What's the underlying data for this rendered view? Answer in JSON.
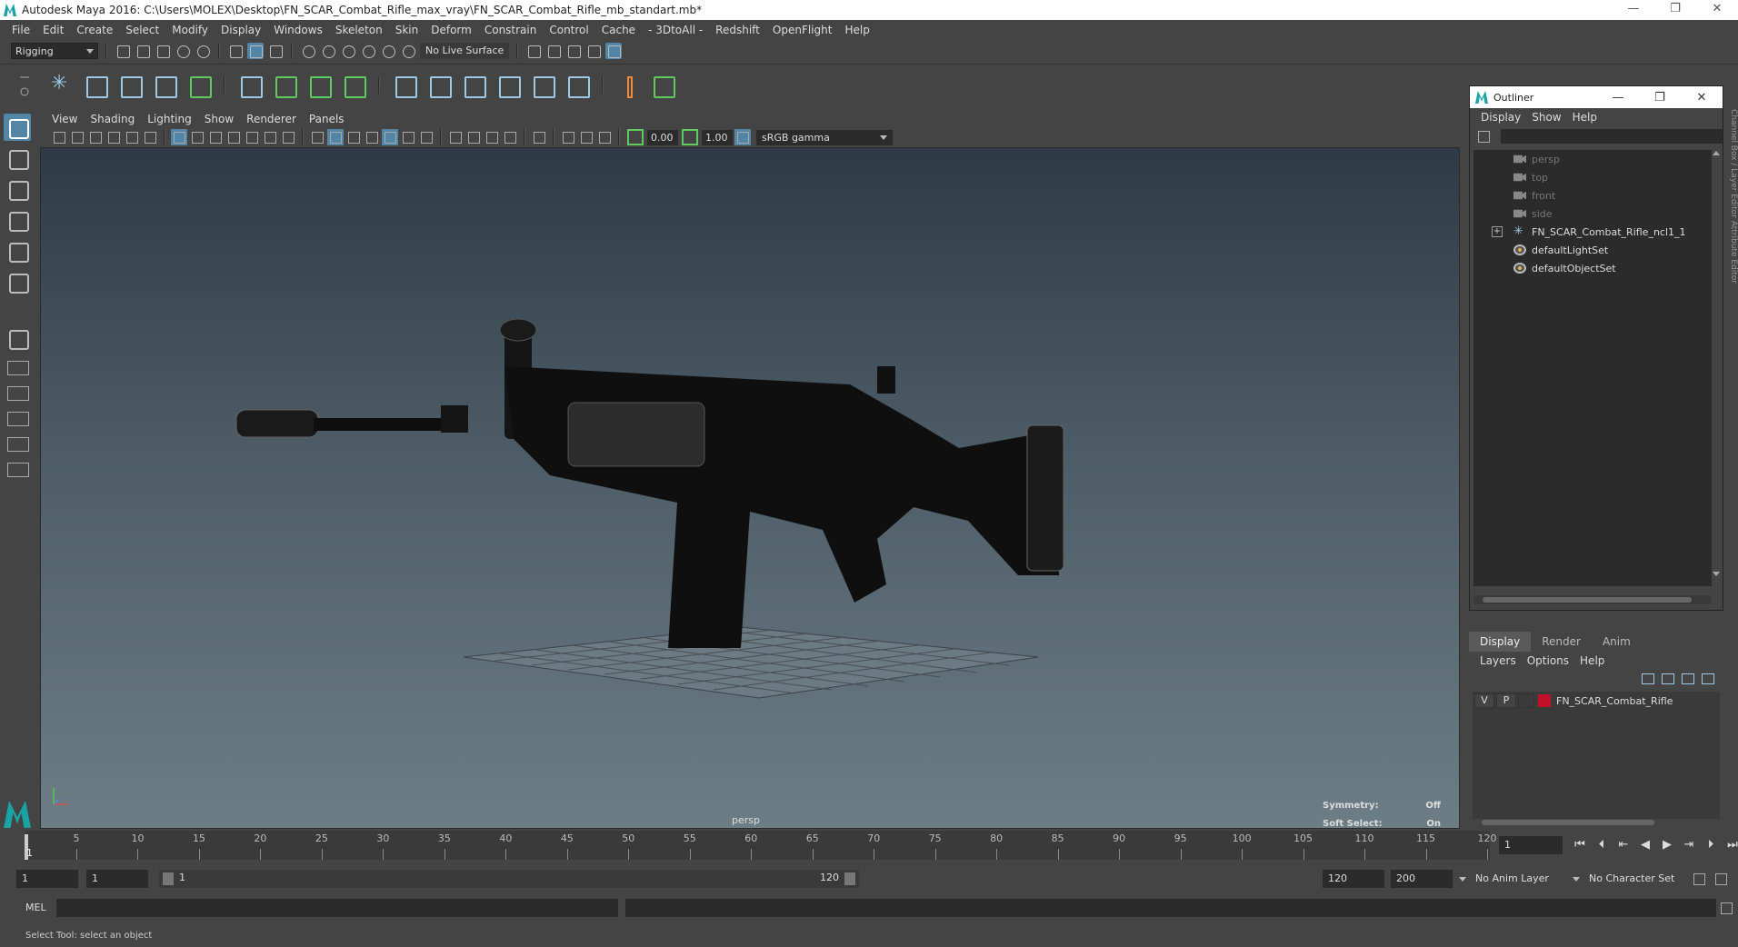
{
  "window": {
    "title": "Autodesk Maya 2016: C:\\Users\\MOLEX\\Desktop\\FN_SCAR_Combat_Rifle_max_vray\\FN_SCAR_Combat_Rifle_mb_standart.mb*",
    "minimize": "—",
    "restore": "❐",
    "close": "✕"
  },
  "menubar": [
    "File",
    "Edit",
    "Create",
    "Select",
    "Modify",
    "Display",
    "Windows",
    "Skeleton",
    "Skin",
    "Deform",
    "Constrain",
    "Control",
    "Cache",
    "- 3DtoAll -",
    "Redshift",
    "OpenFlight",
    "Help"
  ],
  "statusline": {
    "menuset": "Rigging",
    "live_surface": "No Live Surface"
  },
  "panel": {
    "menu": [
      "View",
      "Shading",
      "Lighting",
      "Show",
      "Renderer",
      "Panels"
    ],
    "exposure": "0.00",
    "gamma_value": "1.00",
    "color_space": "sRGB gamma",
    "camera_label": "persp",
    "symmetry_label": "Symmetry:",
    "symmetry_value": "Off",
    "soft_select_label": "Soft Select:",
    "soft_select_value": "On"
  },
  "outliner": {
    "title": "Outliner",
    "menu": [
      "Display",
      "Show",
      "Help"
    ],
    "items": [
      {
        "label": "persp",
        "icon": "camera-icon",
        "dim": true
      },
      {
        "label": "top",
        "icon": "camera-icon",
        "dim": true
      },
      {
        "label": "front",
        "icon": "camera-icon",
        "dim": true
      },
      {
        "label": "side",
        "icon": "camera-icon",
        "dim": true
      },
      {
        "label": "FN_SCAR_Combat_Rifle_ncl1_1",
        "icon": "mesh-group-icon",
        "dim": false,
        "expand": "+"
      },
      {
        "label": "defaultLightSet",
        "icon": "set-icon",
        "dim": false
      },
      {
        "label": "defaultObjectSet",
        "icon": "set-icon",
        "dim": false
      }
    ]
  },
  "side_tabs": "Channel Box / Layer Editor    Attribute Editor",
  "layer_editor": {
    "tabs": [
      "Display",
      "Render",
      "Anim"
    ],
    "menu": [
      "Layers",
      "Options",
      "Help"
    ],
    "layers": [
      {
        "v": "V",
        "p": "P",
        "name": "FN_SCAR_Combat_Rifle",
        "color": "#c0102a"
      }
    ]
  },
  "timeline": {
    "ticks": [
      "5",
      "10",
      "15",
      "20",
      "25",
      "30",
      "35",
      "40",
      "45",
      "50",
      "55",
      "60",
      "65",
      "70",
      "75",
      "80",
      "85",
      "90",
      "95",
      "100",
      "105",
      "110",
      "115",
      "120"
    ],
    "range_start": 1,
    "range_end": 120,
    "current_frame": "1",
    "current_frame_field": "1"
  },
  "range": {
    "start_time": "1",
    "playback_start": "1",
    "slider_start": "1",
    "slider_end": "120",
    "playback_end": "120",
    "end_time": "200",
    "anim_layer": "No Anim Layer",
    "character_set": "No Character Set"
  },
  "commandline": {
    "label": "MEL"
  },
  "helpline": {
    "text": "Select Tool: select an object"
  }
}
